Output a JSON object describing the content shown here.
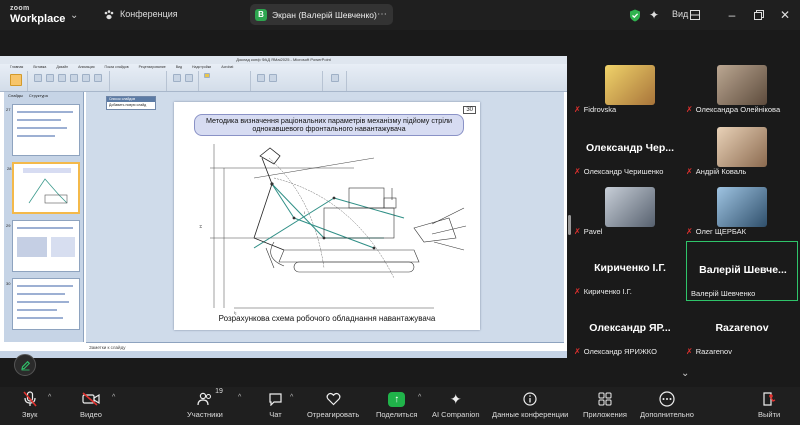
{
  "app": {
    "logo_line1": "zoom",
    "logo_line2": "Workplace",
    "meeting_title": "Конференция",
    "share_badge": "В",
    "share_label": "Экран (Валерій Шевченко)",
    "view_label": "Вид",
    "accent_green": "#2fc46a"
  },
  "presentation": {
    "window_title": "Доклад конф ФАД ЯМаі2025 - Microsoft PowerPoint",
    "ribbon_tabs": [
      "Главная",
      "Вставка",
      "Дизайн",
      "Анимация",
      "Показ слайдов",
      "Рецензирование",
      "Вид",
      "Надстройки",
      "Acrobat"
    ],
    "pane_tabs": [
      "Слайды",
      "Структура"
    ],
    "popup_title": "Список слайдов",
    "popup_item": "Добавить новую слайд",
    "slide_number": "30",
    "slide_title": "Методика визначення раціональних параметрів механізму підйому стріли однокавшевого фронтального навантажувача",
    "slide_caption": "Розрахункова схема робочого обладнання навантажувача",
    "notes_placeholder": "Заметки к слайду",
    "thumb_numbers": [
      "27",
      "28",
      "29",
      "30",
      "31"
    ]
  },
  "participants": [
    {
      "name": "Fidrovska",
      "display": "",
      "photo_color": "#b08a4c"
    },
    {
      "name": "Олександра Олейнікова",
      "display": "",
      "photo_color": "#8a7b6a"
    },
    {
      "name": "Олександр Черишенко",
      "display": "Олександр Чер...",
      "photo_color": ""
    },
    {
      "name": "Андрій Коваль",
      "display": "",
      "photo_color": "#c9a98a"
    },
    {
      "name": "Pavel",
      "display": "",
      "photo_color": "#6e7f93"
    },
    {
      "name": "Олег ЩЕРБАК",
      "display": "",
      "photo_color": "#5a8fb8"
    },
    {
      "name": "Кириченко І.Г.",
      "display": "Кириченко І.Г.",
      "photo_color": ""
    },
    {
      "name": "Валерій Шевченко",
      "display": "Валерій Шевче...",
      "photo_color": ""
    },
    {
      "name": "Олександр ЯРИЖКО",
      "display": "Олександр ЯР...",
      "photo_color": ""
    },
    {
      "name": "Razarenov",
      "display": "Razarenov",
      "photo_color": ""
    }
  ],
  "toolbar": {
    "audio": "Звук",
    "video": "Видео",
    "participants": "Участники",
    "participants_count": "19",
    "chat": "Чат",
    "react": "Отреагировать",
    "share": "Поделиться",
    "ai": "AI Companion",
    "meeting_info": "Данные конференции",
    "apps": "Приложения",
    "more": "Дополнительно",
    "leave": "Выйти"
  }
}
